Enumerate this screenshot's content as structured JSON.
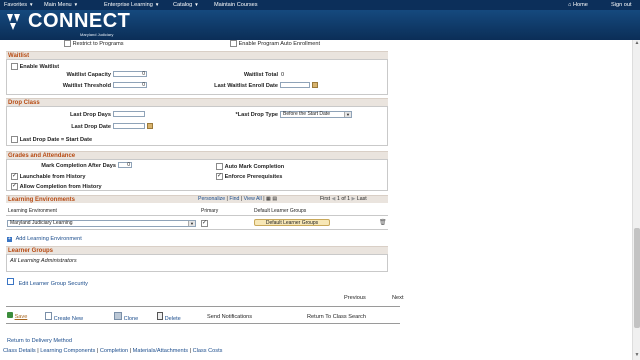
{
  "topnav": {
    "favorites": "Favorites",
    "main_menu": "Main Menu",
    "enterprise_learning": "Enterprise Learning",
    "catalog": "Catalog",
    "maintain_courses": "Maintain Courses",
    "home": "Home",
    "sign_out": "Sign out"
  },
  "header": {
    "logo_text": "CONNECT",
    "logo_sub": "Maryland Judiciary"
  },
  "programs": {
    "restrict_label": "Restrict to Programs",
    "enable_auto_enroll_label": "Enable Program Auto Enrollment"
  },
  "waitlist": {
    "title": "Waitlist",
    "enable_label": "Enable Waitlist",
    "capacity_label": "Waitlist Capacity",
    "capacity_value": "0",
    "threshold_label": "Waitlist Threshold",
    "threshold_value": "0",
    "total_label": "Waitlist Total",
    "total_value": "0",
    "last_enroll_label": "Last Waitlist Enroll Date",
    "last_enroll_value": ""
  },
  "drop_class": {
    "title": "Drop Class",
    "last_drop_days_label": "Last Drop Days",
    "last_drop_days_value": "",
    "last_drop_date_label": "Last Drop Date",
    "last_drop_date_value": "",
    "last_drop_type_label": "*Last Drop Type",
    "last_drop_type_value": "Before the Start Date",
    "equal_start_label": "Last Drop Date = Start Date"
  },
  "grades": {
    "title": "Grades and Attendance",
    "mark_after_label": "Mark Completion After Days",
    "mark_after_value": "0",
    "auto_mark_label": "Auto Mark Completion",
    "launchable_label": "Launchable from History",
    "enforce_prereq_label": "Enforce Prerequisites",
    "allow_completion_label": "Allow Completion from History"
  },
  "learning_env": {
    "title": "Learning Environments",
    "personalize": "Personalize",
    "find": "Find",
    "view_all": "View All",
    "first": "First",
    "pager": "1 of 1",
    "last": "Last",
    "col_env": "Learning Environment",
    "col_primary": "Primary",
    "col_groups": "Default Learner Groups",
    "env_value": "Maryland Judiciary Learning",
    "groups_button": "Default Learner Groups",
    "add_link": "Add Learning Environment"
  },
  "learner_groups": {
    "title": "Learner Groups",
    "value": "All Learning Administrators",
    "edit_link": "Edit Learner Group Security"
  },
  "pager_nav": {
    "previous": "Previous",
    "next": "Next"
  },
  "actions": {
    "save": "Save",
    "create_new": "Create New",
    "clone": "Clone",
    "delete": "Delete",
    "send_notifications": "Send Notifications",
    "return_to_search": "Return To Class Search"
  },
  "footer": {
    "return_delivery": "Return to Delivery Method",
    "links": [
      "Class Details",
      "Learning Components",
      "Completion",
      "Materials/Attachments",
      "Class Costs"
    ]
  }
}
